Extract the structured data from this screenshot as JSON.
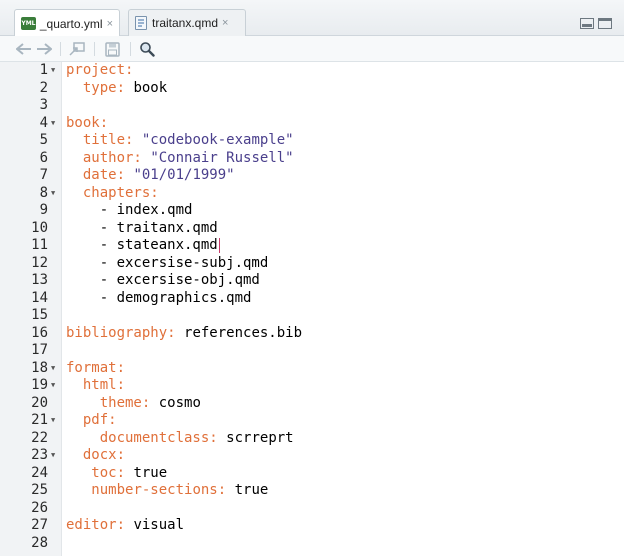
{
  "tabs": [
    {
      "label": "_quarto.yml",
      "icon": "yml-file-icon",
      "icon_text": "YML",
      "active": true
    },
    {
      "label": "traitanx.qmd",
      "icon": "qmd-file-icon",
      "active": false
    }
  ],
  "tab_close_glyph": "×",
  "toolbar": {
    "back_icon": "arrow-left-icon",
    "forward_icon": "arrow-right-icon",
    "show_in_window_icon": "show-in-window-icon",
    "save_icon": "save-icon",
    "search_icon": "search-icon"
  },
  "editor": {
    "lines": [
      {
        "n": "1",
        "fold": true,
        "indent": "",
        "key": "project:",
        "sep": "",
        "value": "",
        "str": false
      },
      {
        "n": "2",
        "fold": false,
        "indent": "  ",
        "key": "type:",
        "sep": " ",
        "value": "book",
        "str": false
      },
      {
        "n": "3",
        "fold": false,
        "indent": "",
        "key": "",
        "sep": "",
        "value": "",
        "str": false
      },
      {
        "n": "4",
        "fold": true,
        "indent": "",
        "key": "book:",
        "sep": "",
        "value": "",
        "str": false
      },
      {
        "n": "5",
        "fold": false,
        "indent": "  ",
        "key": "title:",
        "sep": " ",
        "value": "\"codebook-example\"",
        "str": true
      },
      {
        "n": "6",
        "fold": false,
        "indent": "  ",
        "key": "author:",
        "sep": " ",
        "value": "\"Connair Russell\"",
        "str": true
      },
      {
        "n": "7",
        "fold": false,
        "indent": "  ",
        "key": "date:",
        "sep": " ",
        "value": "\"01/01/1999\"",
        "str": true
      },
      {
        "n": "8",
        "fold": true,
        "indent": "  ",
        "key": "chapters:",
        "sep": "",
        "value": "",
        "str": false
      },
      {
        "n": "9",
        "fold": false,
        "indent": "    ",
        "key": "",
        "sep": "",
        "value": "- index.qmd",
        "str": false
      },
      {
        "n": "10",
        "fold": false,
        "indent": "    ",
        "key": "",
        "sep": "",
        "value": "- traitanx.qmd",
        "str": false
      },
      {
        "n": "11",
        "fold": false,
        "indent": "    ",
        "key": "",
        "sep": "",
        "value": "- stateanx.qmd",
        "str": false,
        "cursor": true
      },
      {
        "n": "12",
        "fold": false,
        "indent": "    ",
        "key": "",
        "sep": "",
        "value": "- excersise-subj.qmd",
        "str": false
      },
      {
        "n": "13",
        "fold": false,
        "indent": "    ",
        "key": "",
        "sep": "",
        "value": "- excersise-obj.qmd",
        "str": false
      },
      {
        "n": "14",
        "fold": false,
        "indent": "    ",
        "key": "",
        "sep": "",
        "value": "- demographics.qmd",
        "str": false
      },
      {
        "n": "15",
        "fold": false,
        "indent": "",
        "key": "",
        "sep": "",
        "value": "",
        "str": false
      },
      {
        "n": "16",
        "fold": false,
        "indent": "",
        "key": "bibliography:",
        "sep": " ",
        "value": "references.bib",
        "str": false
      },
      {
        "n": "17",
        "fold": false,
        "indent": "",
        "key": "",
        "sep": "",
        "value": "",
        "str": false
      },
      {
        "n": "18",
        "fold": true,
        "indent": "",
        "key": "format:",
        "sep": "",
        "value": "",
        "str": false
      },
      {
        "n": "19",
        "fold": true,
        "indent": "  ",
        "key": "html:",
        "sep": "",
        "value": "",
        "str": false
      },
      {
        "n": "20",
        "fold": false,
        "indent": "    ",
        "key": "theme:",
        "sep": " ",
        "value": "cosmo",
        "str": false
      },
      {
        "n": "21",
        "fold": true,
        "indent": "  ",
        "key": "pdf:",
        "sep": "",
        "value": "",
        "str": false
      },
      {
        "n": "22",
        "fold": false,
        "indent": "    ",
        "key": "documentclass:",
        "sep": " ",
        "value": "scrreprt",
        "str": false
      },
      {
        "n": "23",
        "fold": true,
        "indent": "  ",
        "key": "docx:",
        "sep": "",
        "value": "",
        "str": false
      },
      {
        "n": "24",
        "fold": false,
        "indent": "   ",
        "key": "toc:",
        "sep": " ",
        "value": "true",
        "str": false
      },
      {
        "n": "25",
        "fold": false,
        "indent": "   ",
        "key": "number-sections:",
        "sep": " ",
        "value": "true",
        "str": false
      },
      {
        "n": "26",
        "fold": false,
        "indent": "",
        "key": "",
        "sep": "",
        "value": "",
        "str": false
      },
      {
        "n": "27",
        "fold": false,
        "indent": "",
        "key": "editor:",
        "sep": " ",
        "value": "visual",
        "str": false
      },
      {
        "n": "28",
        "fold": false,
        "indent": "",
        "key": "",
        "sep": "",
        "value": "",
        "str": false
      }
    ]
  },
  "colors": {
    "key": "#e0703a",
    "string": "#4a3f8c",
    "text": "#000000",
    "gutter_bg": "#f1f3f5"
  }
}
